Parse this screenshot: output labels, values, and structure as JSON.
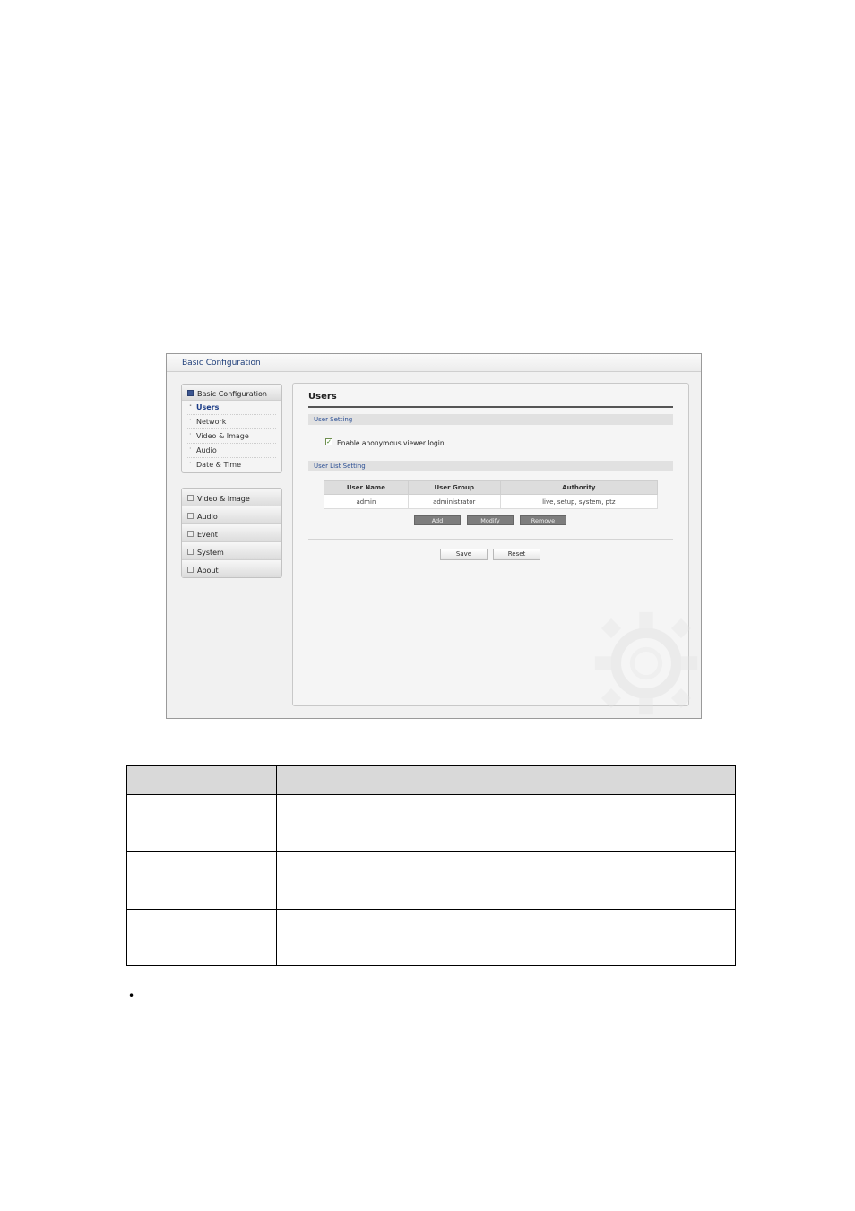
{
  "window": {
    "title": "Basic Configuration"
  },
  "sidebar": {
    "groups": [
      {
        "label": "Basic Configuration",
        "expanded": true,
        "items": [
          {
            "label": "Users",
            "active": true
          },
          {
            "label": "Network"
          },
          {
            "label": "Video & Image"
          },
          {
            "label": "Audio"
          },
          {
            "label": "Date & Time"
          }
        ]
      }
    ],
    "collapsed": [
      {
        "label": "Video & Image"
      },
      {
        "label": "Audio"
      },
      {
        "label": "Event"
      },
      {
        "label": "System"
      },
      {
        "label": "About"
      }
    ]
  },
  "main": {
    "title": "Users",
    "user_setting": {
      "header": "User Setting",
      "checkbox_label": "Enable anonymous viewer login",
      "checked": true
    },
    "user_list": {
      "header": "User List Setting",
      "columns": [
        "User Name",
        "User Group",
        "Authority"
      ],
      "rows": [
        [
          "admin",
          "administrator",
          "live, setup, system, ptz"
        ]
      ],
      "buttons": {
        "add": "Add",
        "modify": "Modify",
        "remove": "Remove"
      }
    },
    "buttons": {
      "save": "Save",
      "reset": "Reset"
    }
  },
  "colors": {
    "accent": "#1a3b86",
    "panel_bg": "#f5f5f5",
    "button_dark": "#7d7d7d"
  },
  "document_table": {
    "header": [
      "",
      ""
    ],
    "rows": [
      [
        "",
        ""
      ],
      [
        "",
        ""
      ],
      [
        "",
        ""
      ]
    ]
  },
  "bullet": "•"
}
